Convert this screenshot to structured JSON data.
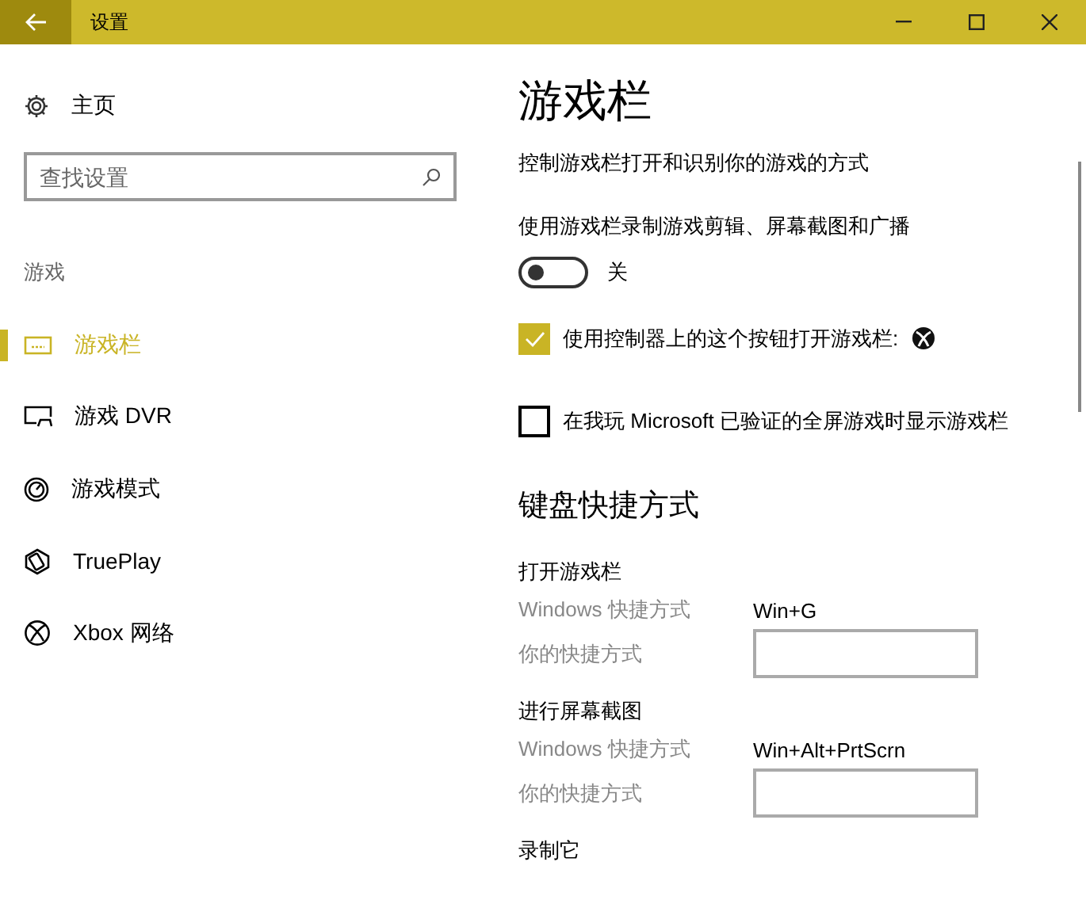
{
  "window": {
    "title": "设置"
  },
  "sidebar": {
    "home": "主页",
    "search": {
      "placeholder": "查找设置"
    },
    "section": "游戏",
    "items": [
      {
        "label": "游戏栏",
        "selected": true
      },
      {
        "label": "游戏 DVR",
        "selected": false
      },
      {
        "label": "游戏模式",
        "selected": false
      },
      {
        "label": "TruePlay",
        "selected": false
      },
      {
        "label": "Xbox 网络",
        "selected": false
      }
    ]
  },
  "content": {
    "title": "游戏栏",
    "description": "控制游戏栏打开和识别你的游戏的方式",
    "toggle": {
      "label": "使用游戏栏录制游戏剪辑、屏幕截图和广播",
      "on": false,
      "state_text": "关"
    },
    "checkboxes": [
      {
        "label": "使用控制器上的这个按钮打开游戏栏:",
        "checked": true,
        "xbox_icon": true
      },
      {
        "label": "在我玩 Microsoft 已验证的全屏游戏时显示游戏栏",
        "checked": false,
        "xbox_icon": false
      }
    ],
    "shortcuts": {
      "heading": "键盘快捷方式",
      "groups": [
        {
          "title": "打开游戏栏",
          "rows": [
            {
              "kind": "text",
              "label": "Windows 快捷方式",
              "value": "Win+G"
            },
            {
              "kind": "field",
              "label": "你的快捷方式"
            }
          ]
        },
        {
          "title": "进行屏幕截图",
          "rows": [
            {
              "kind": "text",
              "label": "Windows 快捷方式",
              "value": "Win+Alt+PrtScrn"
            },
            {
              "kind": "field",
              "label": "你的快捷方式"
            }
          ]
        },
        {
          "title": "录制它"
        }
      ]
    }
  }
}
